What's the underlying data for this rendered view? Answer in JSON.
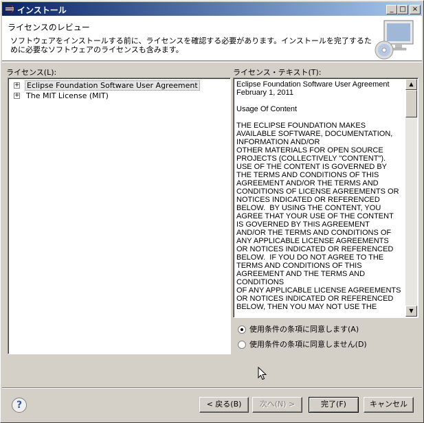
{
  "window": {
    "title": "インストール",
    "controls": {
      "minimize": "_",
      "maximize": "□",
      "close": "×"
    }
  },
  "header": {
    "title": "ライセンスのレビュー",
    "description": "ソフトウェアをインストールする前に、ライセンスを確認する必要があります。インストールを完了するために必要なソフトウェアのライセンスも含みます。"
  },
  "licenses": {
    "label": "ライセンス(L):",
    "items": [
      {
        "label": "Eclipse Foundation Software User Agreement",
        "selected": true
      },
      {
        "label": "The MIT License (MIT)",
        "selected": false
      }
    ]
  },
  "license_text": {
    "label": "ライセンス・テキスト(T):",
    "content": "Eclipse Foundation Software User Agreement\nFebruary 1, 2011\n\nUsage Of Content\n\nTHE ECLIPSE FOUNDATION MAKES\nAVAILABLE SOFTWARE, DOCUMENTATION,\nINFORMATION AND/OR\nOTHER MATERIALS FOR OPEN SOURCE\nPROJECTS (COLLECTIVELY \"CONTENT\").\nUSE OF THE CONTENT IS GOVERNED BY\nTHE TERMS AND CONDITIONS OF THIS\nAGREEMENT AND/OR THE TERMS AND\nCONDITIONS OF LICENSE AGREEMENTS OR\nNOTICES INDICATED OR REFERENCED\nBELOW.  BY USING THE CONTENT, YOU\nAGREE THAT YOUR USE OF THE CONTENT\nIS GOVERNED BY THIS AGREEMENT\nAND/OR THE TERMS AND CONDITIONS OF\nANY APPLICABLE LICENSE AGREEMENTS\nOR NOTICES INDICATED OR REFERENCED\nBELOW.  IF YOU DO NOT AGREE TO THE\nTERMS AND CONDITIONS OF THIS\nAGREEMENT AND THE TERMS AND\nCONDITIONS\nOF ANY APPLICABLE LICENSE AGREEMENTS\nOR NOTICES INDICATED OR REFERENCED\nBELOW, THEN YOU MAY NOT USE THE"
  },
  "options": {
    "accept": "使用条件の条項に同意します(A)",
    "decline": "使用条件の条項に同意しません(D)",
    "selected": "accept"
  },
  "buttons": {
    "help": "?",
    "back": "< 戻る(B)",
    "next": "次へ(N) >",
    "finish": "完了(F)",
    "cancel": "キャンセル"
  },
  "colors": {
    "titlebar_start": "#0a246a",
    "titlebar_end": "#a6caf0",
    "dialog_bg": "#d4d0c8"
  }
}
